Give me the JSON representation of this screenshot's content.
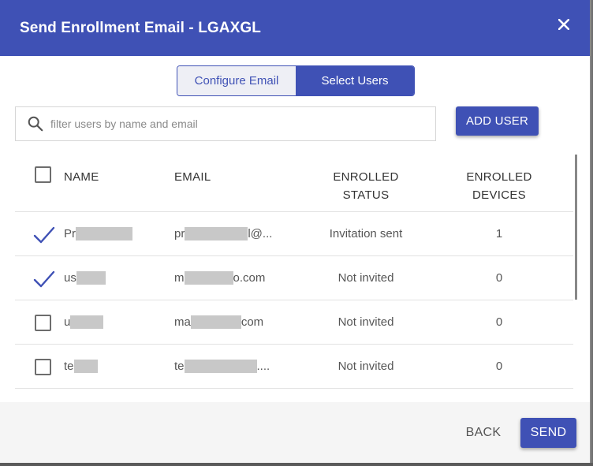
{
  "dialog": {
    "title": "Send Enrollment Email - LGAXGL",
    "close_icon": "close-icon"
  },
  "tabs": [
    {
      "label": "Configure Email",
      "active": false
    },
    {
      "label": "Select Users",
      "active": true
    }
  ],
  "search": {
    "placeholder": "filter users by name and email",
    "value": "",
    "icon": "search-icon"
  },
  "add_user_label": "ADD USER",
  "table": {
    "headers": {
      "name": "NAME",
      "email": "EMAIL",
      "status_line1": "ENROLLED",
      "status_line2": "STATUS",
      "devices_line1": "ENROLLED",
      "devices_line2": "DEVICES"
    },
    "rows": [
      {
        "selected": true,
        "name_prefix": "Pr",
        "name_visible_tail": "",
        "email_prefix": "pr",
        "email_suffix": "l@...",
        "status": "Invitation sent",
        "devices": "1"
      },
      {
        "selected": true,
        "name_prefix": "us",
        "name_visible_tail": "",
        "email_prefix": "m",
        "email_suffix": "o.com",
        "status": "Not invited",
        "devices": "0"
      },
      {
        "selected": false,
        "name_prefix": "u",
        "name_visible_tail": "",
        "email_prefix": "ma",
        "email_suffix": "com",
        "status": "Not invited",
        "devices": "0"
      },
      {
        "selected": false,
        "name_prefix": "te",
        "name_visible_tail": "",
        "email_prefix": "te",
        "email_suffix": "....",
        "status": "Not invited",
        "devices": "0"
      }
    ]
  },
  "footer": {
    "back_label": "BACK",
    "send_label": "SEND"
  },
  "colors": {
    "primary": "#3f51b5",
    "check": "#3f51b5"
  }
}
